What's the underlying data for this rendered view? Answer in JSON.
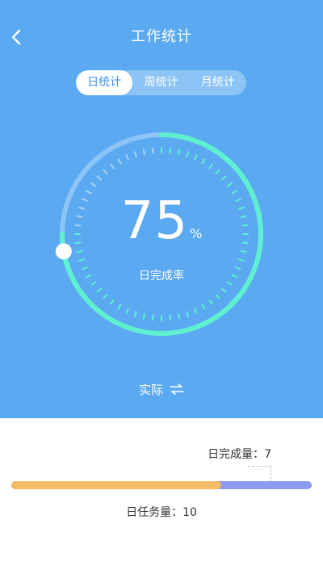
{
  "header": {
    "title": "工作统计",
    "back_icon": "chevron-left-icon"
  },
  "tabs": [
    {
      "label": "日统计",
      "active": true
    },
    {
      "label": "周统计",
      "active": false
    },
    {
      "label": "月统计",
      "active": false
    }
  ],
  "gauge": {
    "percent_value": "75",
    "percent_unit": "%",
    "progress": 0.75,
    "label": "日完成率",
    "track_color": "#8cc4f6",
    "progress_color": "#5ef0cf"
  },
  "toggle": {
    "label": "实际",
    "icon": "swap-arrows-icon"
  },
  "stats": {
    "done_label": "日完成量：7",
    "task_label": "日任务量：10",
    "done": 7,
    "total": 10,
    "done_color": "#f5bb65",
    "remaining_color": "#8a9bf0"
  }
}
